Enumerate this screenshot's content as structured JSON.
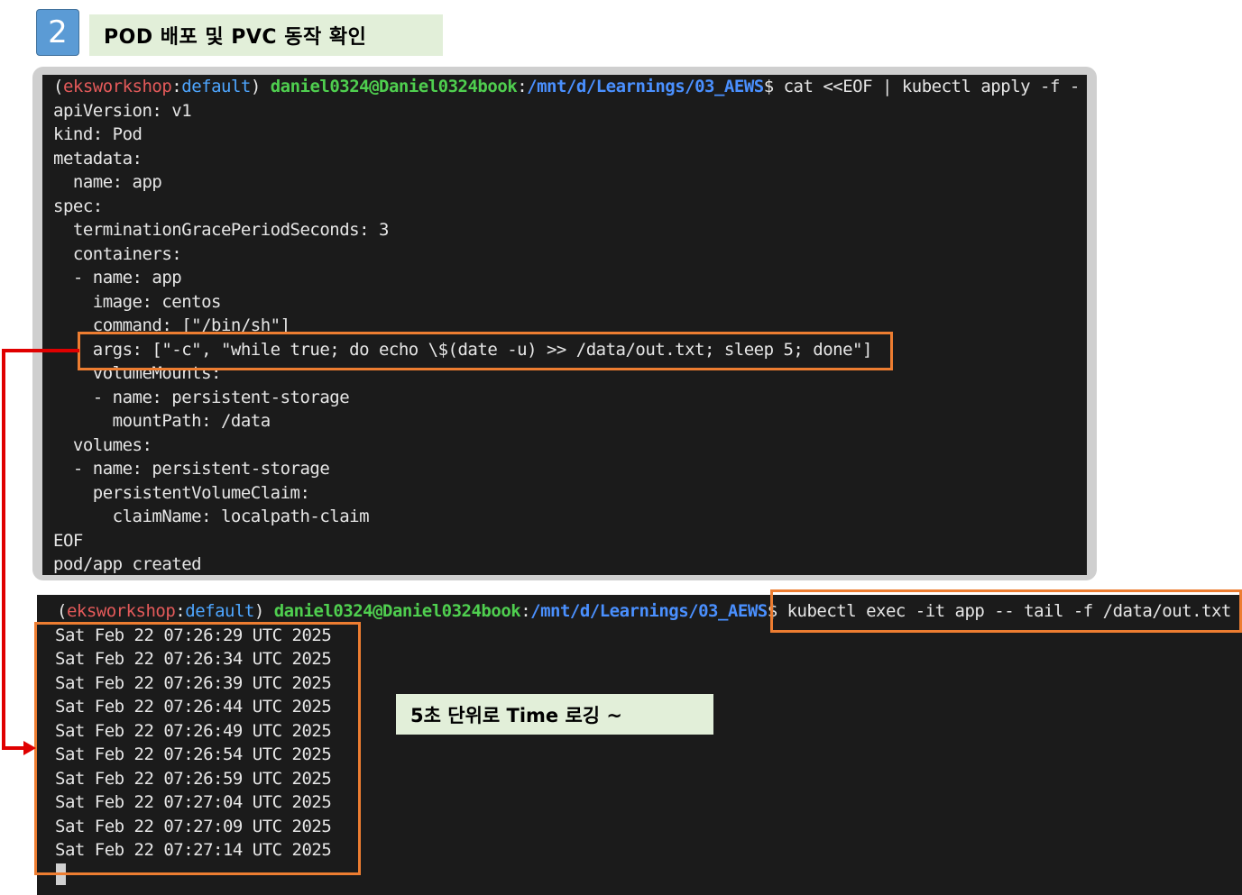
{
  "header": {
    "step_number": "2",
    "title": "POD 배포 및 PVC 동작 확인"
  },
  "colors": {
    "badge_bg": "#5b9bd5",
    "title_bg": "#e2efd9",
    "terminal_bg": "#1b1b1b",
    "highlight": "#ed7d31",
    "arrow": "#e00000",
    "prompt_cluster": "#e45a5a",
    "prompt_namespace": "#4ea6ff",
    "prompt_user": "#4fcf4f",
    "prompt_path": "#4a90ff"
  },
  "terminal1": {
    "prompt": {
      "open": "(",
      "cluster": "eksworkshop",
      "sep": ":",
      "namespace": "default",
      "close": ") ",
      "user": "daniel0324@Daniel0324book",
      "colon": ":",
      "path": "/mnt/d/Learnings/03_AEWS",
      "dollar": "$ ",
      "command": "cat <<EOF | kubectl apply -f -"
    },
    "lines": [
      "apiVersion: v1",
      "kind: Pod",
      "metadata:",
      "  name: app",
      "spec:",
      "  terminationGracePeriodSeconds: 3",
      "  containers:",
      "  - name: app",
      "    image: centos",
      "    command: [\"/bin/sh\"]",
      "    args: [\"-c\", \"while true; do echo \\$(date -u) >> /data/out.txt; sleep 5; done\"]",
      "    volumeMounts:",
      "    - name: persistent-storage",
      "      mountPath: /data",
      "  volumes:",
      "  - name: persistent-storage",
      "    persistentVolumeClaim:",
      "      claimName: localpath-claim",
      "EOF",
      "pod/app created"
    ]
  },
  "terminal2": {
    "prompt": {
      "open": "(",
      "cluster": "eksworkshop",
      "sep": ":",
      "namespace": "default",
      "close": ") ",
      "user": "daniel0324@Daniel0324book",
      "colon": ":",
      "path": "/mnt/d/Learnings/03_AEWS",
      "dollar": "$ ",
      "command": "kubectl exec -it app -- tail -f /data/out.txt"
    },
    "lines": [
      "Sat Feb 22 07:26:29 UTC 2025",
      "Sat Feb 22 07:26:34 UTC 2025",
      "Sat Feb 22 07:26:39 UTC 2025",
      "Sat Feb 22 07:26:44 UTC 2025",
      "Sat Feb 22 07:26:49 UTC 2025",
      "Sat Feb 22 07:26:54 UTC 2025",
      "Sat Feb 22 07:26:59 UTC 2025",
      "Sat Feb 22 07:27:04 UTC 2025",
      "Sat Feb 22 07:27:09 UTC 2025",
      "Sat Feb 22 07:27:14 UTC 2025"
    ]
  },
  "annotation": {
    "note": "5초 단위로 Time 로깅 ~"
  }
}
